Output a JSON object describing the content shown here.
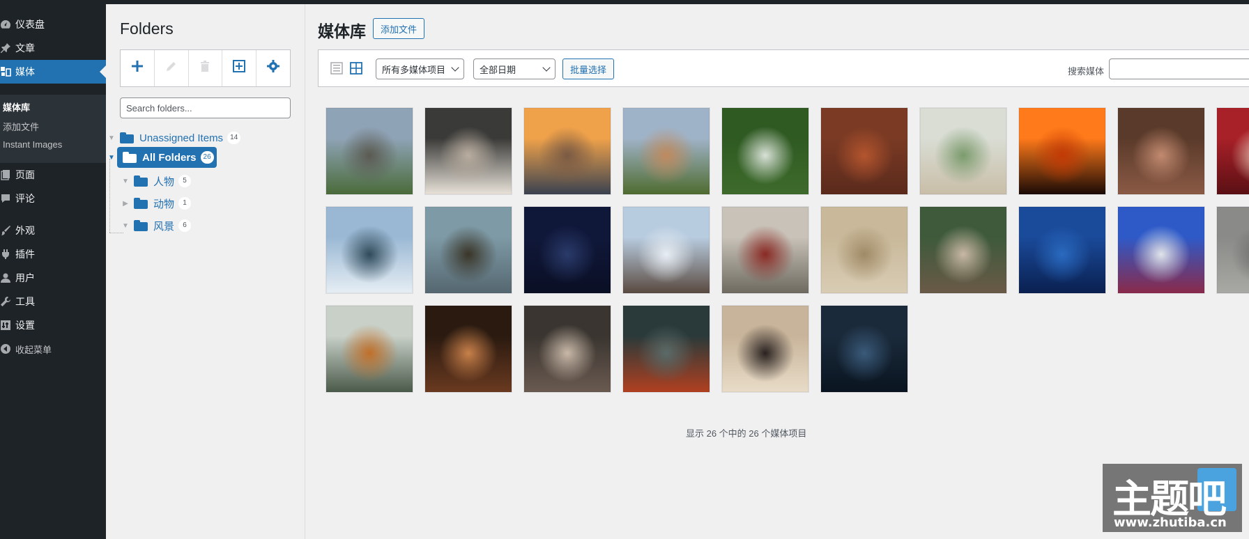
{
  "sidebar": {
    "items": [
      {
        "label": "仪表盘",
        "icon": "dashboard-icon"
      },
      {
        "label": "文章",
        "icon": "pin-icon"
      },
      {
        "label": "媒体",
        "icon": "media-icon"
      },
      {
        "label": "页面",
        "icon": "page-icon"
      },
      {
        "label": "评论",
        "icon": "comment-icon"
      },
      {
        "label": "外观",
        "icon": "brush-icon"
      },
      {
        "label": "插件",
        "icon": "plugin-icon"
      },
      {
        "label": "用户",
        "icon": "user-icon"
      },
      {
        "label": "工具",
        "icon": "wrench-icon"
      },
      {
        "label": "设置",
        "icon": "settings-icon"
      },
      {
        "label": "收起菜单",
        "icon": "collapse-icon"
      }
    ],
    "submenu": [
      "媒体库",
      "添加文件",
      "Instant Images"
    ],
    "active": "媒体"
  },
  "folders": {
    "title": "Folders",
    "search_placeholder": "Search folders...",
    "toolbar": [
      "add-icon",
      "edit-icon",
      "delete-icon",
      "add-subfolder-icon",
      "settings-icon"
    ],
    "unassigned": {
      "label": "Unassigned Items",
      "count": "14"
    },
    "all": {
      "label": "All Folders",
      "count": "26"
    },
    "children": [
      {
        "label": "人物",
        "count": "5"
      },
      {
        "label": "动物",
        "count": "1"
      },
      {
        "label": "风景",
        "count": "6"
      }
    ]
  },
  "main": {
    "title": "媒体库",
    "add_new": "添加文件",
    "filter_type": "所有多媒体项目",
    "filter_date": "全部日期",
    "bulk_select": "批量选择",
    "search_label": "搜索媒体",
    "footer": "显示 26 个中的 26 个媒体项目"
  },
  "thumbnails": [
    {
      "name": "rocky-mountain",
      "colors": [
        "#8fa3b6",
        "#5b5a52",
        "#4a6b3a"
      ]
    },
    {
      "name": "seal",
      "colors": [
        "#3a3a38",
        "#b9ad9f",
        "#e8e2d9"
      ]
    },
    {
      "name": "city-sunset",
      "colors": [
        "#f0a24a",
        "#7a5a44",
        "#3a4250"
      ]
    },
    {
      "name": "half-dome",
      "colors": [
        "#9fb3c8",
        "#c08a5e",
        "#4f6b2f"
      ]
    },
    {
      "name": "waterfall",
      "colors": [
        "#2f5a22",
        "#d8e1d7",
        "#3e6b2c"
      ]
    },
    {
      "name": "red-hair-woman",
      "colors": [
        "#7a3a24",
        "#b4552e",
        "#5a2a1c"
      ]
    },
    {
      "name": "window-palm",
      "colors": [
        "#d9ddd4",
        "#7b9b6d",
        "#c9bea8"
      ]
    },
    {
      "name": "sunset-silhouette",
      "colors": [
        "#ff7a1a",
        "#c23a06",
        "#1a0a05"
      ]
    },
    {
      "name": "woman-back",
      "colors": [
        "#5a3a2a",
        "#c28a70",
        "#8a5a45"
      ]
    },
    {
      "name": "red-partial",
      "colors": [
        "#a82028",
        "#eac3b3",
        "#5a1014"
      ]
    },
    {
      "name": "snow-forest",
      "colors": [
        "#9ab8d4",
        "#2f4a5a",
        "#e6eef4"
      ]
    },
    {
      "name": "lighthouse",
      "colors": [
        "#7e9aa6",
        "#3a3528",
        "#556770"
      ]
    },
    {
      "name": "starry-sky",
      "colors": [
        "#10183a",
        "#2a3a6a",
        "#0a0f24"
      ]
    },
    {
      "name": "snow-village",
      "colors": [
        "#b8cce0",
        "#e8eef4",
        "#5a4a40"
      ]
    },
    {
      "name": "train-interior",
      "colors": [
        "#c8c2b8",
        "#8a2a24",
        "#6e6a60"
      ]
    },
    {
      "name": "wheat",
      "colors": [
        "#c9b99a",
        "#a08a66",
        "#d8ccb4"
      ]
    },
    {
      "name": "palm-beach",
      "colors": [
        "#3e5a3a",
        "#c8b8a4",
        "#6a5a48"
      ]
    },
    {
      "name": "star-trails",
      "colors": [
        "#1a4a9a",
        "#2a6ac0",
        "#0a2050"
      ]
    },
    {
      "name": "blossom-building",
      "colors": [
        "#2e5ac8",
        "#e0e4ea",
        "#8a2a4a"
      ]
    },
    {
      "name": "grey-partial",
      "colors": [
        "#8a8a88",
        "#6a6a68",
        "#a8a8a4"
      ]
    },
    {
      "name": "cat",
      "colors": [
        "#c8d0c8",
        "#c0702a",
        "#4a5a4a"
      ]
    },
    {
      "name": "abstract-brown",
      "colors": [
        "#2a1a10",
        "#c8804a",
        "#6a3a20"
      ]
    },
    {
      "name": "blur-face",
      "colors": [
        "#3a3530",
        "#c8b8a8",
        "#6a5a50"
      ]
    },
    {
      "name": "lake-boat",
      "colors": [
        "#2a3a3a",
        "#5a6a68",
        "#b04020"
      ]
    },
    {
      "name": "couple-stairs",
      "colors": [
        "#c8b49a",
        "#2a2220",
        "#e8dcc8"
      ]
    },
    {
      "name": "camera-hands",
      "colors": [
        "#1a2a3a",
        "#3a5a7a",
        "#0a1420"
      ]
    }
  ]
}
